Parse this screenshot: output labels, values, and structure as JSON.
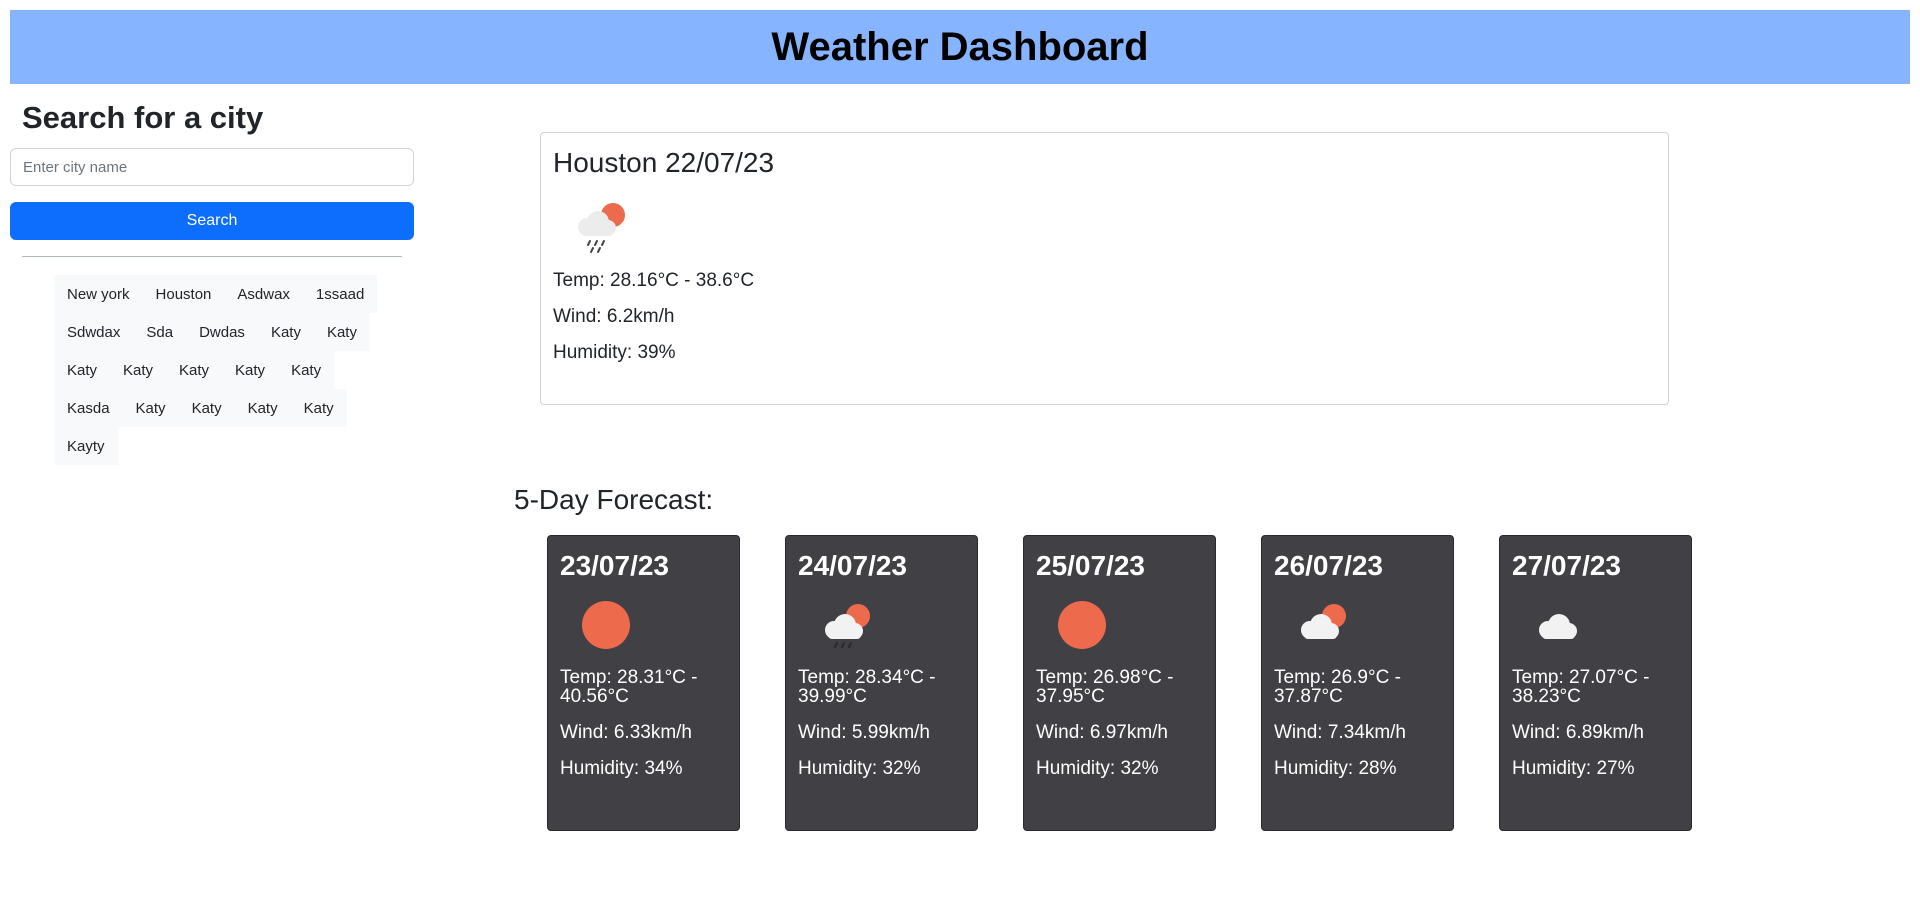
{
  "header": {
    "title": "Weather Dashboard",
    "bg_color": "#87b4ff"
  },
  "sidebar": {
    "heading": "Search for a city",
    "search_placeholder": "Enter city name",
    "search_value": "",
    "search_button": "Search",
    "accent_color": "#0d6efd",
    "history": [
      [
        "New york",
        "Houston",
        "Asdwax",
        "1ssaad"
      ],
      [
        "Sdwdax",
        "Sda",
        "Dwdas",
        "Katy",
        "Katy"
      ],
      [
        "Katy",
        "Katy",
        "Katy",
        "Katy",
        "Katy"
      ],
      [
        "Kasda",
        "Katy",
        "Katy",
        "Katy",
        "Katy"
      ],
      [
        "Kayty"
      ]
    ]
  },
  "current": {
    "title": "Houston 22/07/23",
    "icon": "cloud-sun-rain-icon",
    "temp": "Temp: 28.16°C - 38.6°C",
    "wind": "Wind: 6.2km/h",
    "humidity": "Humidity: 39%"
  },
  "forecast": {
    "title": "5-Day Forecast:",
    "days": [
      {
        "date": "23/07/23",
        "icon": "sun-icon",
        "temp_line1": "Temp: 28.31°C -",
        "temp_line2": "40.56°C",
        "wind": "Wind: 6.33km/h",
        "humidity": "Humidity: 34%"
      },
      {
        "date": "24/07/23",
        "icon": "cloud-sun-rain-icon",
        "temp_line1": "Temp: 28.34°C -",
        "temp_line2": "39.99°C",
        "wind": "Wind: 5.99km/h",
        "humidity": "Humidity: 32%"
      },
      {
        "date": "25/07/23",
        "icon": "sun-icon",
        "temp_line1": "Temp: 26.98°C -",
        "temp_line2": "37.95°C",
        "wind": "Wind: 6.97km/h",
        "humidity": "Humidity: 32%"
      },
      {
        "date": "26/07/23",
        "icon": "cloud-sun-icon",
        "temp_line1": "Temp: 26.9°C -",
        "temp_line2": "37.87°C",
        "wind": "Wind: 7.34km/h",
        "humidity": "Humidity: 28%"
      },
      {
        "date": "27/07/23",
        "icon": "cloud-icon",
        "temp_line1": "Temp: 27.07°C -",
        "temp_line2": "38.23°C",
        "wind": "Wind: 6.89km/h",
        "humidity": "Humidity: 27%"
      }
    ]
  }
}
